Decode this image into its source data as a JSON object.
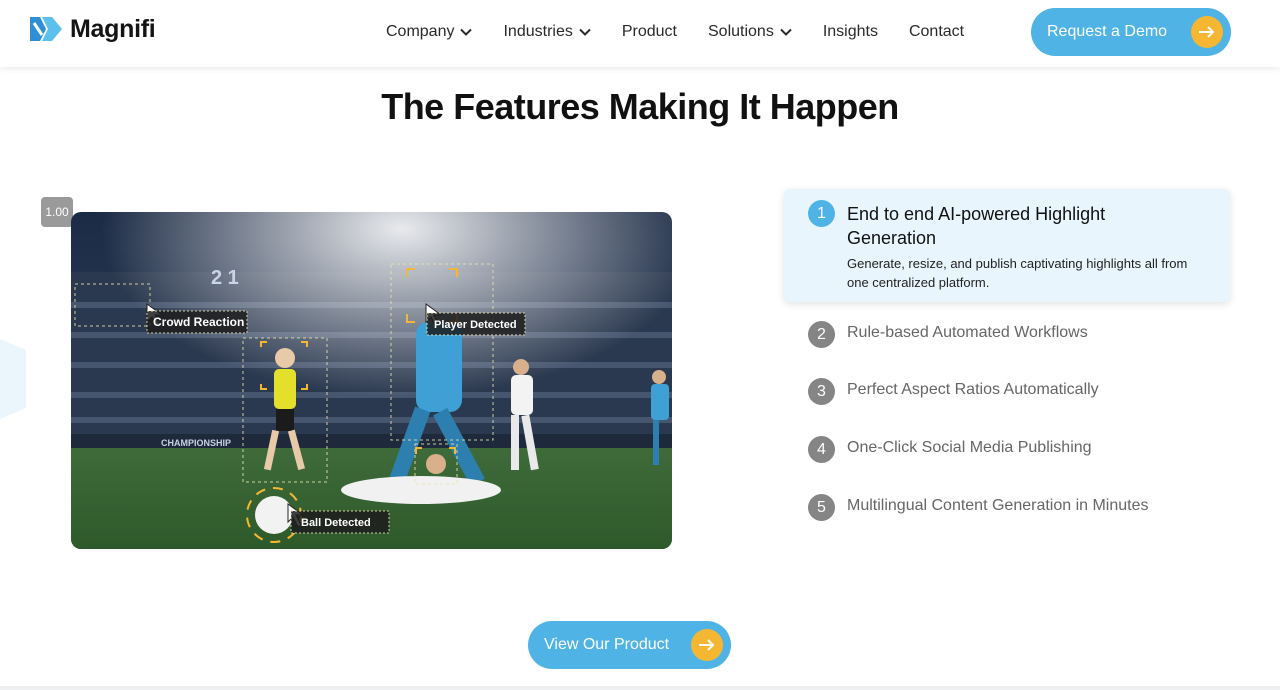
{
  "brand": {
    "name": "Magnifi",
    "accent": "#4fb3e6",
    "cta_arrow_color": "#f5b731"
  },
  "nav": {
    "items": [
      {
        "label": "Company",
        "has_dropdown": true
      },
      {
        "label": "Industries",
        "has_dropdown": true
      },
      {
        "label": "Product",
        "has_dropdown": false
      },
      {
        "label": "Solutions",
        "has_dropdown": true
      },
      {
        "label": "Insights",
        "has_dropdown": false
      },
      {
        "label": "Contact",
        "has_dropdown": false
      }
    ],
    "cta_label": "Request a Demo"
  },
  "section": {
    "title": "The Features Making It Happen"
  },
  "video": {
    "speed_label": "1.00",
    "overlay_labels": {
      "crowd": "Crowd Reaction",
      "player": "Player Detected",
      "ball": "Ball Detected",
      "scoreboard": "2 1",
      "banner": "CHAMPIONSHIP"
    }
  },
  "features": {
    "active": {
      "number": "1",
      "title": "End to end AI-powered Highlight Generation",
      "description": "Generate, resize, and publish captivating highlights all from one centralized platform."
    },
    "items": [
      {
        "number": "2",
        "title": "Rule-based Automated Workflows"
      },
      {
        "number": "3",
        "title": "Perfect Aspect Ratios Automatically"
      },
      {
        "number": "4",
        "title": "One-Click Social Media Publishing"
      },
      {
        "number": "5",
        "title": "Multilingual Content Generation in Minutes"
      }
    ]
  },
  "footer_cta": {
    "label": "View Our Product"
  }
}
